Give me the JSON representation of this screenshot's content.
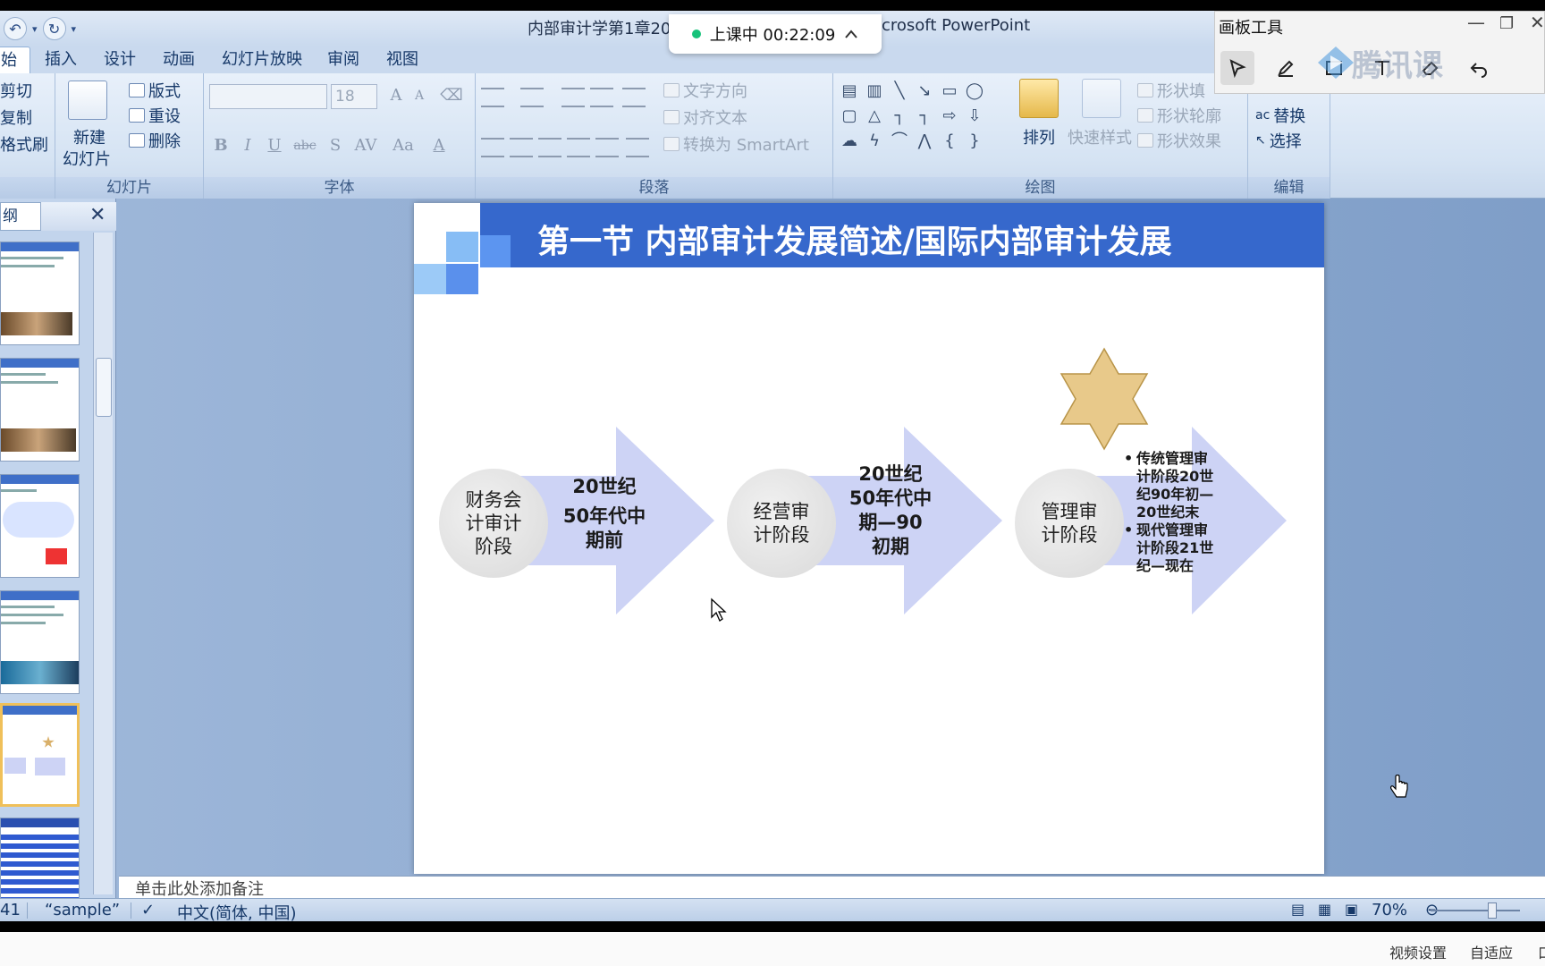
{
  "window": {
    "title_left": "内部审计学第1章20",
    "title_right": "crosoft PowerPoint"
  },
  "live_status": {
    "label": "上课中 00:22:09",
    "dot_color": "#17c27a"
  },
  "quick_access": {
    "undo": "↶",
    "redo": "↻",
    "more": "▾"
  },
  "menu_tabs": [
    "始",
    "插入",
    "设计",
    "动画",
    "幻灯片放映",
    "审阅",
    "视图"
  ],
  "ribbon": {
    "clipboard": {
      "cut": "剪切",
      "copy": "复制",
      "format_painter": "格式刷"
    },
    "slides": {
      "new_slide_line1": "新建",
      "new_slide_line2": "幻灯片",
      "layout": "版式",
      "reset": "重设",
      "delete": "删除",
      "label": "幻灯片"
    },
    "font": {
      "font_name": "",
      "font_size": "18",
      "label": "字体",
      "buttons": [
        "B",
        "I",
        "U",
        "abc",
        "S",
        "AV",
        "Aa",
        "A"
      ]
    },
    "paragraph": {
      "text_direction": "文字方向",
      "align_text": "对齐文本",
      "convert_smartart": "转换为 SmartArt",
      "label": "段落"
    },
    "drawing": {
      "arrange": "排列",
      "quick_styles": "快速样式",
      "shape_fill": "形状填",
      "shape_outline": "形状轮廓",
      "shape_effects": "形状效果",
      "label": "绘图"
    },
    "editing": {
      "replace": "替换",
      "select": "选择",
      "label": "编辑"
    }
  },
  "pen_toolbar": {
    "title": "画板工具",
    "minimize": "—",
    "maximize": "❐",
    "close": "✕"
  },
  "watermark": "腾讯课",
  "thumb_panel": {
    "tab_label": "纲",
    "close": "✕"
  },
  "slide": {
    "title": "第一节 内部审计发展简述/国际内部审计发展",
    "stages": [
      {
        "circle": [
          "财务会",
          "计审计",
          "阶段"
        ],
        "text": [
          "20世纪",
          "50年代中",
          "期前"
        ]
      },
      {
        "circle": [
          "经营审",
          "计阶段"
        ],
        "text": [
          "20世纪",
          "50年代中",
          "期—90",
          "初期"
        ]
      },
      {
        "circle": [
          "管理审",
          "计阶段"
        ],
        "bullets": [
          [
            "传统管理审",
            "计阶段20世",
            "纪90年初—",
            "20世纪末"
          ],
          [
            "现代管理审",
            "计阶段21世",
            "纪—现在"
          ]
        ]
      }
    ],
    "title_bar_color": "#3668cc",
    "arrow_color": "#cdd3f5"
  },
  "notes_placeholder": "单击此处添加备注",
  "status_bar": {
    "slide_info": "41",
    "theme": "“sample”",
    "language": "中文(简体, 中国)",
    "zoom": "70%"
  },
  "player_bar": {
    "video_settings": "视频设置",
    "auto_fit": "自适应",
    "edge": "口"
  }
}
